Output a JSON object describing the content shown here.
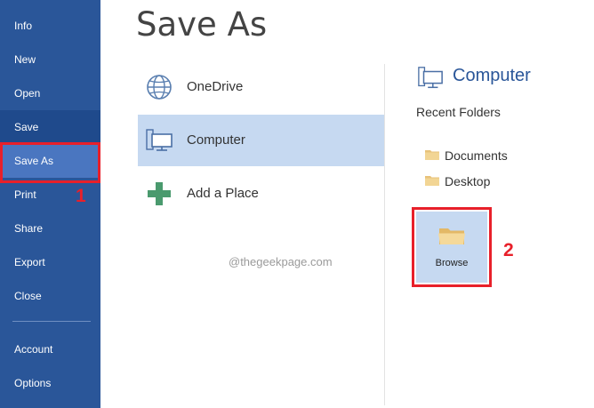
{
  "sidebar": {
    "items": [
      {
        "label": "Info"
      },
      {
        "label": "New"
      },
      {
        "label": "Open"
      },
      {
        "label": "Save"
      },
      {
        "label": "Save As"
      },
      {
        "label": "Print"
      },
      {
        "label": "Share"
      },
      {
        "label": "Export"
      },
      {
        "label": "Close"
      },
      {
        "label": "Account"
      },
      {
        "label": "Options"
      }
    ],
    "active": "Save As"
  },
  "page": {
    "title": "Save As"
  },
  "places": [
    {
      "label": "OneDrive",
      "icon": "globe-icon"
    },
    {
      "label": "Computer",
      "icon": "computer-icon",
      "selected": true
    },
    {
      "label": "Add a Place",
      "icon": "plus-icon"
    }
  ],
  "right_panel": {
    "title": "Computer",
    "recent_label": "Recent Folders",
    "folders": [
      {
        "label": "Documents"
      },
      {
        "label": "Desktop"
      }
    ],
    "browse_label": "Browse"
  },
  "watermark": "@thegeekpage.com",
  "annotations": {
    "step1": "1",
    "step2": "2"
  },
  "colors": {
    "sidebar": "#2a5699",
    "active_item": "#4a76c0",
    "selected_place": "#c6d9f1",
    "accent_title": "#2a5699",
    "annotation": "#e8202a"
  }
}
